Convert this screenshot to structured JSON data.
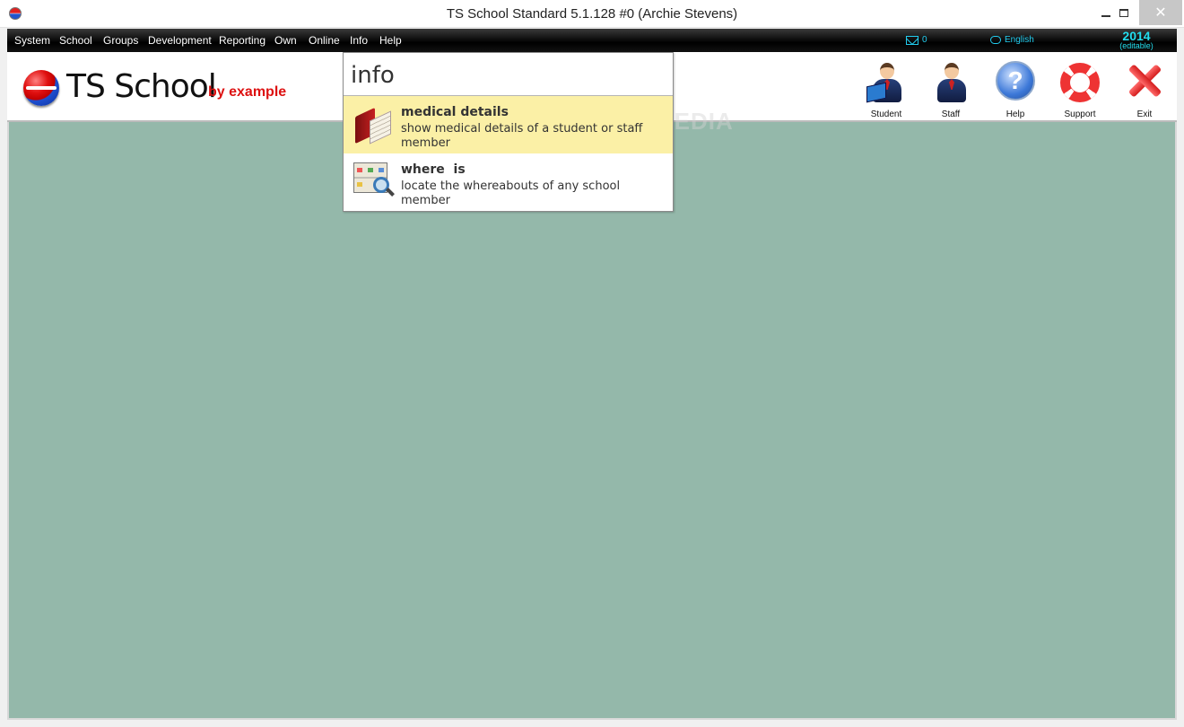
{
  "window": {
    "title": "TS School Standard 5.1.128 #0 (Archie Stevens)",
    "minimize": "minimize",
    "maximize": "maximize",
    "close": "✕"
  },
  "menubar": {
    "items": [
      "System",
      "School",
      "Groups",
      "Development",
      "Reporting",
      "Own",
      "Online",
      "Info",
      "Help"
    ],
    "mail_count": "0",
    "language": "English",
    "year": "2014",
    "year_note": "(editable)"
  },
  "header": {
    "logo_text": "TS School",
    "logo_tagline": "by example",
    "toolbar": [
      {
        "label": "Student",
        "icon": "student-icon"
      },
      {
        "label": "Staff",
        "icon": "staff-icon"
      },
      {
        "label": "Help",
        "icon": "help-icon"
      },
      {
        "label": "Support",
        "icon": "lifebuoy-icon"
      },
      {
        "label": "Exit",
        "icon": "exit-icon"
      }
    ],
    "help_glyph": "?"
  },
  "popup": {
    "search_value": "info",
    "results": [
      {
        "title": "medical details",
        "description": "show medical details of a student or staff member",
        "icon": "medical-book-icon",
        "highlighted": true
      },
      {
        "title": "where  is",
        "description": "locate the whereabouts of any school member",
        "icon": "locate-map-icon",
        "highlighted": false
      }
    ]
  },
  "watermark": "SOFTPEDIA",
  "colors": {
    "workspace": "#94b8aa",
    "highlight": "#fbf0a6",
    "accent_cyan": "#22ccee",
    "tagline_red": "#dd1111"
  }
}
